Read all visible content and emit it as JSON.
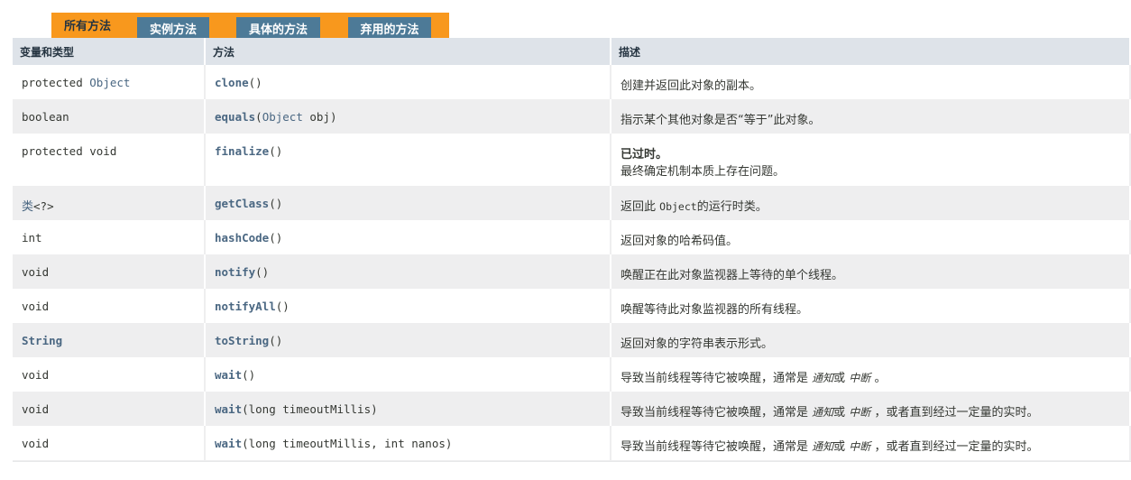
{
  "tabs": [
    {
      "label": "所有方法"
    },
    {
      "label": "实例方法"
    },
    {
      "label": "具体的方法"
    },
    {
      "label": "弃用的方法"
    }
  ],
  "headers": {
    "type": "变量和类型",
    "method": "方法",
    "desc": "描述"
  },
  "rows": [
    {
      "modifier": "protected ",
      "type": "Object",
      "method": "clone",
      "params": "()",
      "desc": "创建并返回此对象的副本。"
    },
    {
      "modifier": "boolean",
      "type": "",
      "method": "equals",
      "params_pre": "(",
      "params_type": "Object",
      "params": " obj)",
      "desc": "指示某个其他对象是否“等于”此对象。"
    },
    {
      "modifier": "protected void",
      "type": "",
      "method": "finalize",
      "params": "()",
      "deprecated": "已过时。",
      "desc": "最终确定机制本质上存在问题。"
    },
    {
      "modifier": "",
      "type": "类",
      "type_suffix": "<?>",
      "method": "getClass",
      "params": "()",
      "desc_pre": "返回此 ",
      "desc_code": "Object",
      "desc": "的运行时类。"
    },
    {
      "modifier": "int",
      "type": "",
      "method": "hashCode",
      "params": "()",
      "desc": "返回对象的哈希码值。"
    },
    {
      "modifier": "void",
      "type": "",
      "method": "notify",
      "params": "()",
      "desc": "唤醒正在此对象监视器上等待的单个线程。"
    },
    {
      "modifier": "void",
      "type": "",
      "method": "notifyAll",
      "params": "()",
      "desc": "唤醒等待此对象监视器的所有线程。"
    },
    {
      "modifier": "",
      "type": "String",
      "method": "toString",
      "params": "()",
      "desc": "返回对象的字符串表示形式。"
    },
    {
      "modifier": "void",
      "type": "",
      "method": "wait",
      "params": "()",
      "desc_pre": "导致当前线程等待它被唤醒，通常是 ",
      "em1": "通知",
      "mid": "或 ",
      "em2": "中断",
      "desc": " 。"
    },
    {
      "modifier": "void",
      "type": "",
      "method": "wait",
      "params": "(long timeoutMillis)",
      "desc_pre": "导致当前线程等待它被唤醒，通常是 ",
      "em1": "通知",
      "mid": "或 ",
      "em2": "中断",
      "desc": " ，或者直到经过一定量的实时。"
    },
    {
      "modifier": "void",
      "type": "",
      "method": "wait",
      "params": "(long timeoutMillis, int nanos)",
      "desc_pre": "导致当前线程等待它被唤醒，通常是 ",
      "em1": "通知",
      "mid": "或 ",
      "em2": "中断",
      "desc": " ，或者直到经过一定量的实时。"
    }
  ]
}
